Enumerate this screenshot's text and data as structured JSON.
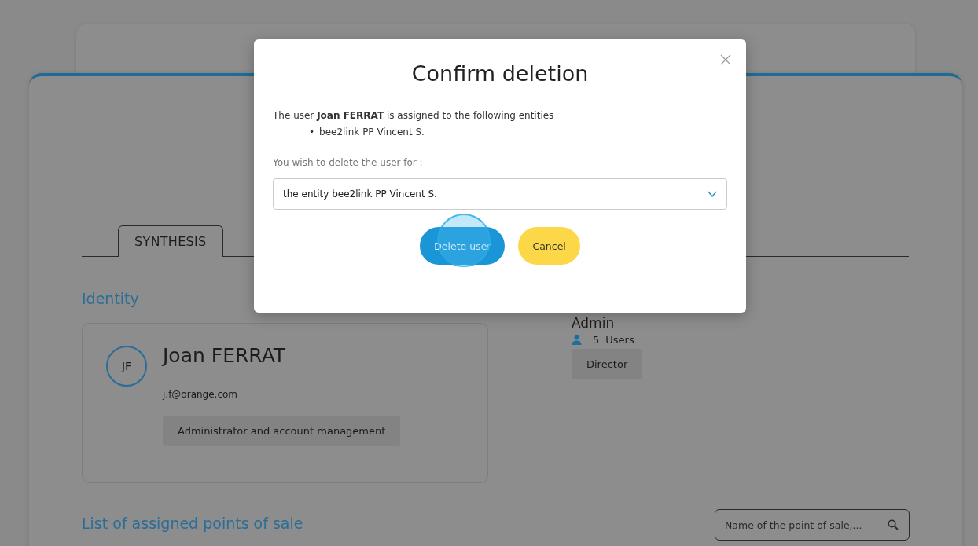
{
  "page": {
    "tabs": [
      {
        "label": "SYNTHESIS",
        "selected": true
      }
    ],
    "identity": {
      "heading": "Identity",
      "initials": "JF",
      "name": "Joan FERRAT",
      "email": "j.f@orange.com",
      "role": "Administrator and account management"
    },
    "group": {
      "name": "Admin",
      "user_count": "5",
      "users_label": "Users",
      "tag": "Director"
    },
    "points_of_sale": {
      "heading": "List of assigned points of sale",
      "search": {
        "placeholder": "Name of the point of sale,..."
      }
    }
  },
  "dialog": {
    "title": "Confirm deletion",
    "message": "The user **Joan FERRAT** is assigned to the following entities",
    "entities": [
      {
        "bullet": "•",
        "text": "bee2link PP Vincent S."
      }
    ],
    "prompt": "You wish to delete the user for :",
    "scope_select": {
      "value": "the entity bee2link PP Vincent S."
    },
    "buttons": [
      {
        "label": "Delete user",
        "kind": "primary"
      },
      {
        "label": "Cancel",
        "kind": "secondary"
      }
    ]
  }
}
